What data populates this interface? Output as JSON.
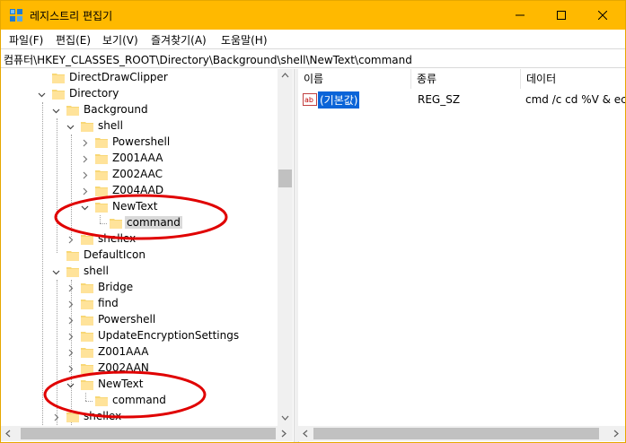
{
  "window": {
    "title": "레지스트리 편집기",
    "controls": [
      "minimize-icon",
      "maximize-icon",
      "close-icon"
    ],
    "accent": "#ffb900"
  },
  "menu": [
    "파일(F)",
    "편집(E)",
    "보기(V)",
    "즐겨찾기(A)",
    "도움말(H)"
  ],
  "address": "컴퓨터\\HKEY_CLASSES_ROOT\\Directory\\Background\\shell\\NewText\\command",
  "tree": [
    {
      "label": "DirectDrawClipper",
      "expanded": null
    },
    {
      "label": "Directory",
      "expanded": true
    },
    {
      "label": "Background",
      "expanded": true
    },
    {
      "label": "shell",
      "expanded": true
    },
    {
      "label": "Powershell",
      "expanded": false
    },
    {
      "label": "Z001AAA",
      "expanded": false
    },
    {
      "label": "Z002AAC",
      "expanded": false
    },
    {
      "label": "Z004AAD",
      "expanded": false
    },
    {
      "label": "NewText",
      "expanded": true
    },
    {
      "label": "command",
      "expanded": null,
      "selected": true
    },
    {
      "label": "shellex",
      "expanded": false
    },
    {
      "label": "DefaultIcon",
      "expanded": null
    },
    {
      "label": "shell",
      "expanded": true
    },
    {
      "label": "Bridge",
      "expanded": false
    },
    {
      "label": "find",
      "expanded": false
    },
    {
      "label": "Powershell",
      "expanded": false
    },
    {
      "label": "UpdateEncryptionSettings",
      "expanded": false
    },
    {
      "label": "Z001AAA",
      "expanded": false
    },
    {
      "label": "Z002AAN",
      "expanded": false
    },
    {
      "label": "NewText",
      "expanded": true
    },
    {
      "label": "command",
      "expanded": null
    },
    {
      "label": "shellex",
      "expanded": false
    }
  ],
  "list": {
    "columns": [
      "이름",
      "종류",
      "데이터"
    ],
    "rows": [
      {
        "name": "(기본값)",
        "type": "REG_SZ",
        "data": "cmd /c cd %V & ec",
        "icon": "string-value-icon"
      }
    ]
  },
  "annotations": {
    "color": "#e00000"
  }
}
